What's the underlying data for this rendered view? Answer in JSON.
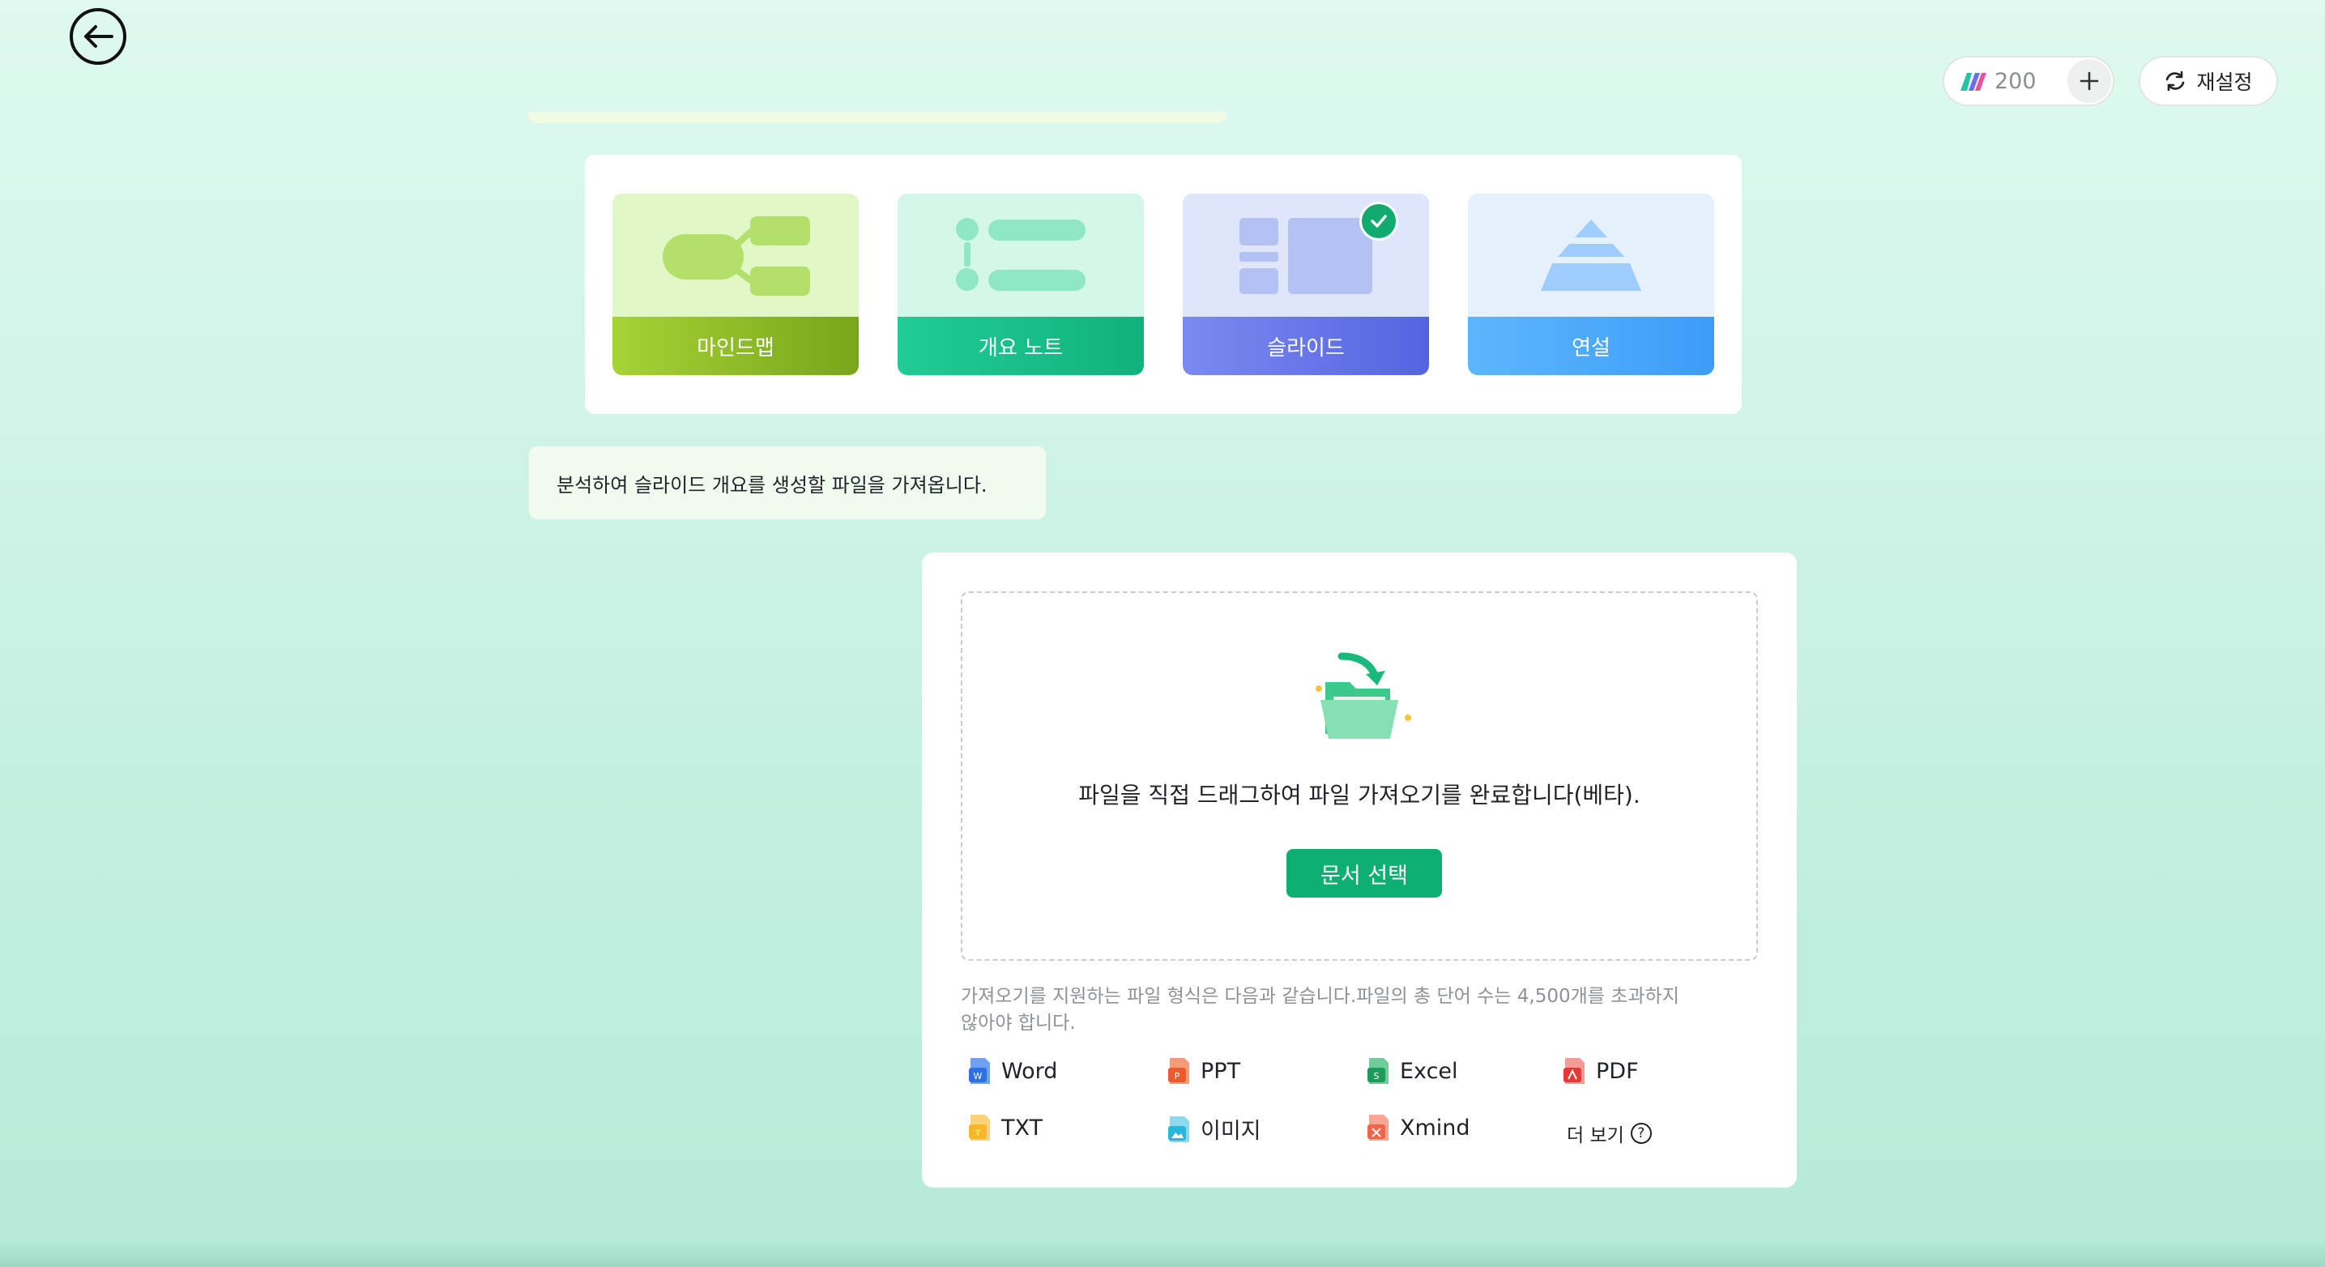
{
  "header": {
    "credits": "200",
    "reset_label": "재설정"
  },
  "modes": [
    {
      "label": "마인드맵",
      "colors": [
        "#a6d335",
        "#78a51a"
      ],
      "art_bg": "#e1f8c6"
    },
    {
      "label": "개요 노트",
      "colors": [
        "#20cc95",
        "#11b27c"
      ],
      "art_bg": "#d3f8ea"
    },
    {
      "label": "슬라이드",
      "colors": [
        "#7b8af0",
        "#5464e0"
      ],
      "art_bg": "#dfe6fb",
      "selected": true
    },
    {
      "label": "연설",
      "colors": [
        "#5db6fd",
        "#3d9cf7"
      ],
      "art_bg": "#e6f1fe"
    }
  ],
  "message": "분석하여 슬라이드 개요를 생성할 파일을 가져옵니다.",
  "upload": {
    "drop_text": "파일을 직접 드래그하여 파일 가져오기를 완료합니다(베타).",
    "choose_label": "문서 선택",
    "info": "가져오기를 지원하는 파일 형식은 다음과 같습니다.파일의 총 단어 수는 4,500개를 초과하지 않아야 합니다.",
    "formats": [
      {
        "label": "Word",
        "icon": "word-file-icon",
        "color": "#2c6fe6"
      },
      {
        "label": "PPT",
        "icon": "ppt-file-icon",
        "color": "#ec5a2d"
      },
      {
        "label": "Excel",
        "icon": "excel-file-icon",
        "color": "#1d9b5a"
      },
      {
        "label": "PDF",
        "icon": "pdf-file-icon",
        "color": "#e53935"
      },
      {
        "label": "TXT",
        "icon": "txt-file-icon",
        "color": "#f5b82b"
      },
      {
        "label": "이미지",
        "icon": "image-file-icon",
        "color": "#28b6dc"
      },
      {
        "label": "Xmind",
        "icon": "xmind-file-icon",
        "color": "#f0654a"
      }
    ],
    "more_label": "더 보기"
  }
}
